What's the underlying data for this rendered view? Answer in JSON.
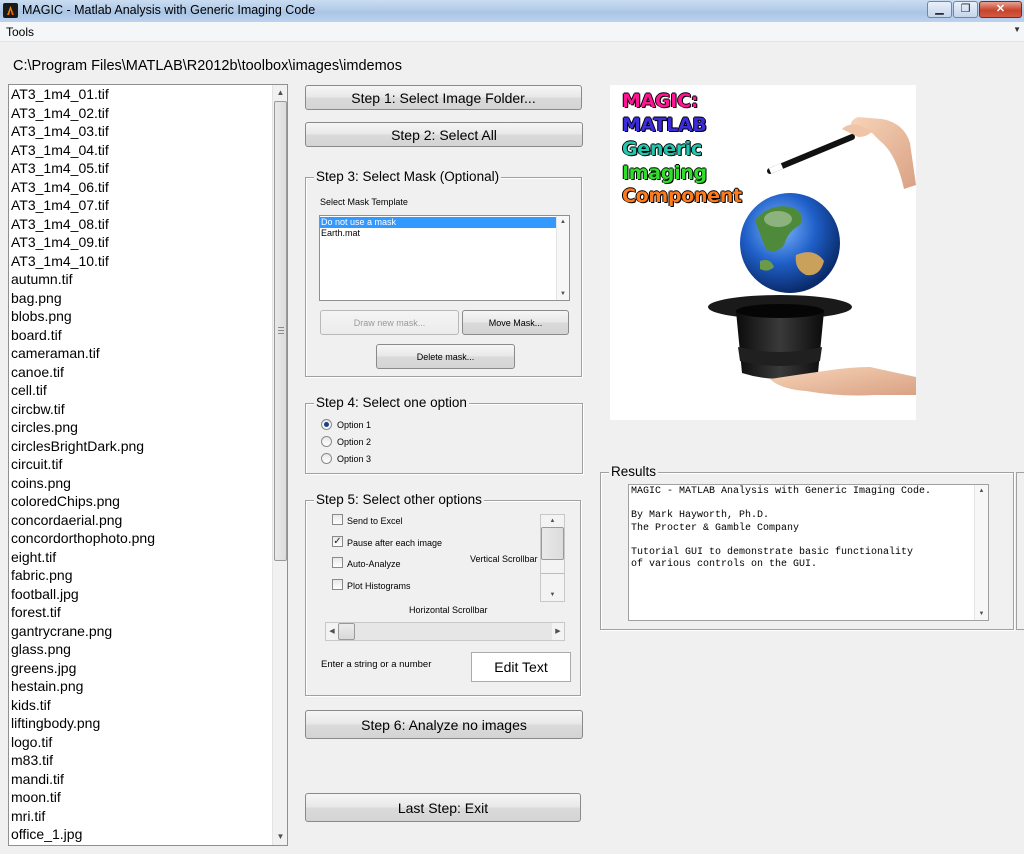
{
  "window": {
    "title": "MAGIC - Matlab Analysis with Generic Imaging Code",
    "minimize_glyph": "▁",
    "maximize_glyph": "❐",
    "close_glyph": "✕"
  },
  "menu": {
    "tools": "Tools"
  },
  "folder_path": "C:\\Program Files\\MATLAB\\R2012b\\toolbox\\images\\imdemos",
  "files": [
    "AT3_1m4_01.tif",
    "AT3_1m4_02.tif",
    "AT3_1m4_03.tif",
    "AT3_1m4_04.tif",
    "AT3_1m4_05.tif",
    "AT3_1m4_06.tif",
    "AT3_1m4_07.tif",
    "AT3_1m4_08.tif",
    "AT3_1m4_09.tif",
    "AT3_1m4_10.tif",
    "autumn.tif",
    "bag.png",
    "blobs.png",
    "board.tif",
    "cameraman.tif",
    "canoe.tif",
    "cell.tif",
    "circbw.tif",
    "circles.png",
    "circlesBrightDark.png",
    "circuit.tif",
    "coins.png",
    "coloredChips.png",
    "concordaerial.png",
    "concordorthophoto.png",
    "eight.tif",
    "fabric.png",
    "football.jpg",
    "forest.tif",
    "gantrycrane.png",
    "glass.png",
    "greens.jpg",
    "hestain.png",
    "kids.tif",
    "liftingbody.png",
    "logo.tif",
    "m83.tif",
    "mandi.tif",
    "moon.tif",
    "mri.tif",
    "office_1.jpg"
  ],
  "step1": {
    "label": "Step 1:  Select Image Folder..."
  },
  "step2": {
    "label": "Step 2:  Select All"
  },
  "step3": {
    "title": "Step 3: Select Mask (Optional)",
    "template_label": "Select Mask Template",
    "masks": [
      "Do not use a mask",
      "Earth.mat"
    ],
    "draw_label": "Draw new mask...",
    "move_label": "Move Mask...",
    "delete_label": "Delete mask..."
  },
  "step4": {
    "title": "Step 4: Select one option",
    "options": [
      "Option 1",
      "Option 2",
      "Option 3"
    ],
    "selected": "Option 1"
  },
  "step5": {
    "title": "Step 5: Select other options",
    "checks": [
      {
        "label": "Send to Excel",
        "checked": false
      },
      {
        "label": "Pause after each image",
        "checked": true
      },
      {
        "label": "Auto-Analyze",
        "checked": false
      },
      {
        "label": "Plot Histograms",
        "checked": false
      }
    ],
    "check_mark": "✓",
    "vertical_label": "Vertical Scrollbar",
    "horizontal_label": "Horizontal Scrollbar",
    "string_label": "Enter a string or a number",
    "edit_value": "Edit Text"
  },
  "step6": {
    "label": "Step 6:  Analyze no images"
  },
  "exit": {
    "label": "Last Step: Exit"
  },
  "logo": {
    "words": [
      "MAGIC:",
      "MATLAB",
      "Generic",
      "Imaging",
      "Component"
    ],
    "colors": [
      "#ff1493",
      "#3b2bd8",
      "#22c7b0",
      "#2ee02a",
      "#ff7a1a"
    ]
  },
  "results": {
    "title": "Results",
    "lines": [
      "MAGIC - MATLAB Analysis with Generic Imaging Code.",
      "",
      "By Mark Hayworth, Ph.D.",
      "The Procter & Gamble Company",
      "",
      "Tutorial GUI to demonstrate basic functionality",
      "of various controls on the GUI."
    ]
  },
  "arrows": {
    "up": "▲",
    "down": "▼",
    "left": "◀",
    "right": "▶"
  }
}
